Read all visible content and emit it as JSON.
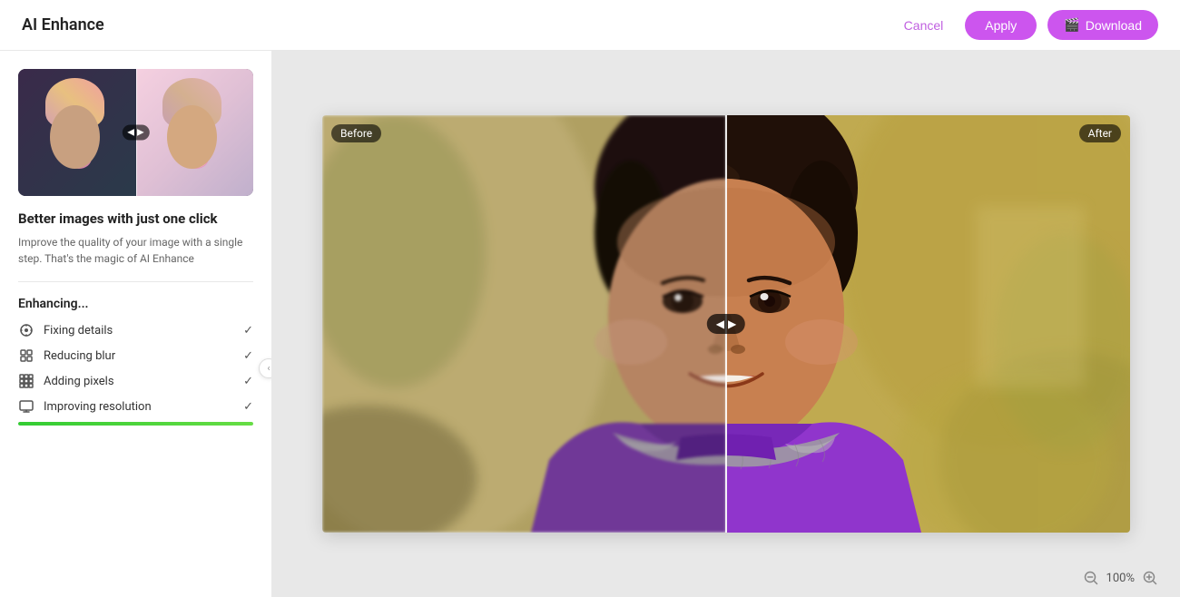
{
  "header": {
    "title": "AI Enhance",
    "cancel_label": "Cancel",
    "apply_label": "Apply",
    "download_label": "Download"
  },
  "sidebar": {
    "description_title": "Better images with just one click",
    "description_text": "Improve the quality of your image with a single step. That's the magic of AI Enhance",
    "enhancing_title": "Enhancing...",
    "steps": [
      {
        "label": "Fixing details",
        "done": true,
        "icon": "settings-icon"
      },
      {
        "label": "Reducing blur",
        "done": true,
        "icon": "grid-icon"
      },
      {
        "label": "Adding pixels",
        "done": true,
        "icon": "grid2-icon"
      },
      {
        "label": "Improving resolution",
        "done": true,
        "icon": "monitor-icon"
      }
    ],
    "progress_percent": 100
  },
  "canvas": {
    "before_label": "Before",
    "after_label": "After"
  },
  "footer": {
    "zoom_level": "100%",
    "zoom_in_label": "+",
    "zoom_out_label": "−"
  }
}
